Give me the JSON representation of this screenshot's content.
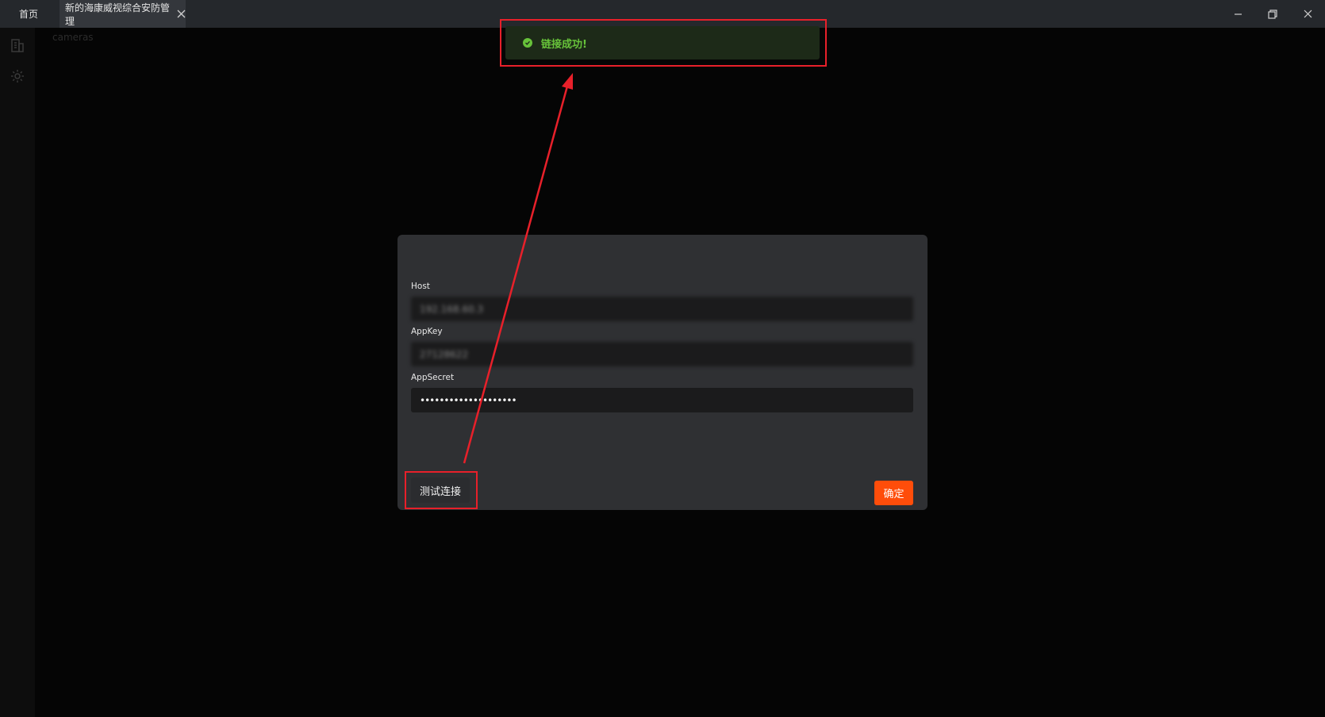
{
  "titlebar": {
    "tabs": [
      {
        "label": "首页"
      },
      {
        "label": "新的海康威视综合安防管理"
      }
    ]
  },
  "sidebar": {
    "items": [
      {
        "icon": "building-icon"
      },
      {
        "icon": "gear-icon"
      }
    ]
  },
  "main": {
    "section_label": "cameras"
  },
  "toast": {
    "message": "链接成功!",
    "icon": "check-circle-icon"
  },
  "dialog": {
    "fields": [
      {
        "label": "Host",
        "value": "192.168.60.3"
      },
      {
        "label": "AppKey",
        "value": "27128622"
      },
      {
        "label": "AppSecret",
        "value": "••••••••••••••••••••"
      }
    ],
    "test_button": "测试连接",
    "confirm_button": "确定"
  },
  "colors": {
    "accent": "#ff4d0a",
    "success": "#67c23a",
    "annotation": "#e8202a",
    "titlebar": "#25282c",
    "dialog": "#2f3033"
  }
}
